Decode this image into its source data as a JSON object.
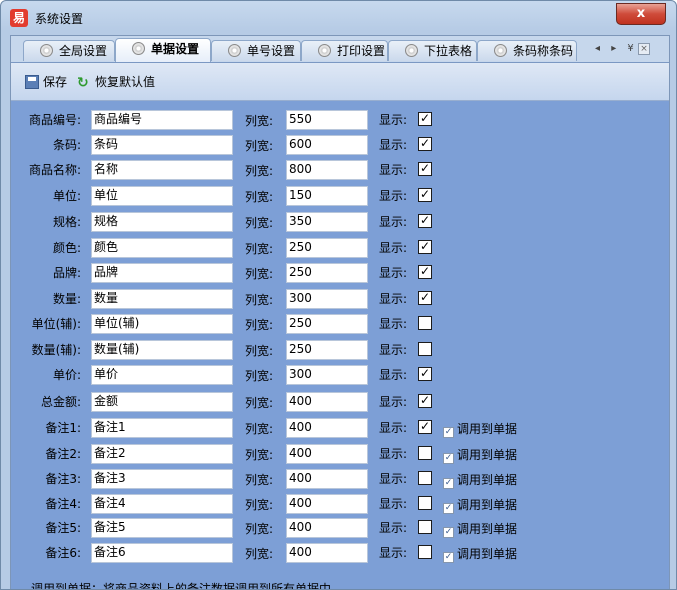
{
  "window": {
    "title": "系统设置",
    "app_icon": "易",
    "close": "x"
  },
  "tabs": [
    {
      "label": "全局设置",
      "active": false
    },
    {
      "label": "单据设置",
      "active": true
    },
    {
      "label": "单号设置",
      "active": false
    },
    {
      "label": "打印设置",
      "active": false
    },
    {
      "label": "下拉表格",
      "active": false
    },
    {
      "label": "条码称条码",
      "active": false
    }
  ],
  "tab_nav": {
    "arrows": "◂ ▸ ¥",
    "close": "×"
  },
  "toolbar": {
    "save_label": "保存",
    "restore_label": "恢复默认值"
  },
  "form": {
    "width_label": "列宽:",
    "display_label": "显示:",
    "apply_label": "调用到单据",
    "rows": [
      {
        "label": "商品编号:",
        "name": "商品编号",
        "width": "550",
        "display": true
      },
      {
        "label": "条码:",
        "name": "条码",
        "width": "600",
        "display": true
      },
      {
        "label": "商品名称:",
        "name": "名称",
        "width": "800",
        "display": true
      },
      {
        "label": "单位:",
        "name": "单位",
        "width": "150",
        "display": true
      },
      {
        "label": "规格:",
        "name": "规格",
        "width": "350",
        "display": true
      },
      {
        "label": "颜色:",
        "name": "颜色",
        "width": "250",
        "display": true
      },
      {
        "label": "品牌:",
        "name": "品牌",
        "width": "250",
        "display": true
      },
      {
        "label": "数量:",
        "name": "数量",
        "width": "300",
        "display": true
      },
      {
        "label": "单位(辅):",
        "name": "单位(辅)",
        "width": "250",
        "display": false
      },
      {
        "label": "数量(辅):",
        "name": "数量(辅)",
        "width": "250",
        "display": false
      },
      {
        "label": "单价:",
        "name": "单价",
        "width": "300",
        "display": true
      },
      {
        "label": "总金额:",
        "name": "金额",
        "width": "400",
        "display": true
      },
      {
        "label": "备注1:",
        "name": "备注1",
        "width": "400",
        "display": true,
        "apply": true
      },
      {
        "label": "备注2:",
        "name": "备注2",
        "width": "400",
        "display": false,
        "apply": true
      },
      {
        "label": "备注3:",
        "name": "备注3",
        "width": "400",
        "display": false,
        "apply": true
      },
      {
        "label": "备注4:",
        "name": "备注4",
        "width": "400",
        "display": false,
        "apply": true
      },
      {
        "label": "备注5:",
        "name": "备注5",
        "width": "400",
        "display": false,
        "apply": true
      },
      {
        "label": "备注6:",
        "name": "备注6",
        "width": "400",
        "display": false,
        "apply": true
      }
    ]
  },
  "footnote": "调用到单据：将商品资料上的备注数据调用到所有单据中",
  "colors": {
    "panel": "#7d9fd6",
    "toolbar": "#c5d6ee",
    "close": "#cf4b3a"
  }
}
